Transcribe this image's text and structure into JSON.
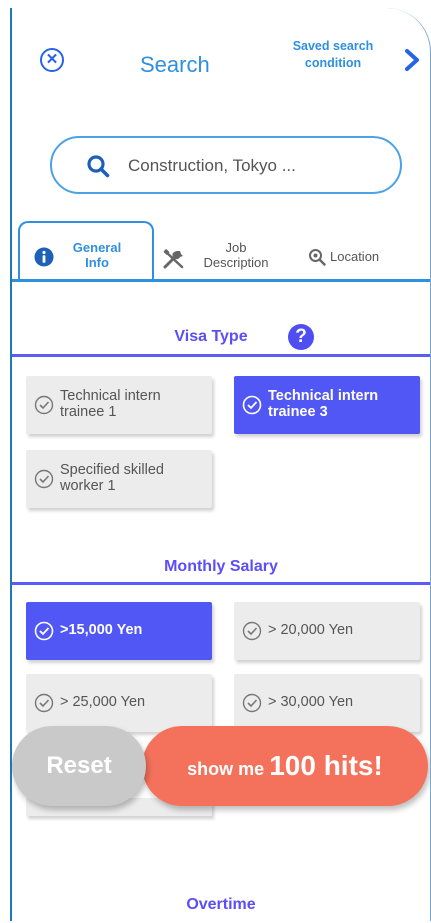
{
  "header": {
    "title": "Search",
    "saved_line1": "Saved search",
    "saved_line2": "condition"
  },
  "search": {
    "placeholder": "Construction, Tokyo ..."
  },
  "tabs": [
    {
      "line1": "General",
      "line2": "Info",
      "active": true
    },
    {
      "line1": "Job",
      "line2": "Description",
      "active": false
    },
    {
      "label": "Location",
      "active": false
    }
  ],
  "visa": {
    "title": "Visa Type",
    "help": "?",
    "options": [
      {
        "line1": "Technical intern",
        "line2": "trainee 1",
        "selected": false
      },
      {
        "line1": "Technical intern",
        "line2": "trainee 3",
        "selected": true
      },
      {
        "line1": "Specified skilled",
        "line2": "worker 1",
        "selected": false
      }
    ]
  },
  "salary": {
    "title": "Monthly Salary",
    "options": [
      {
        "label": ">15,000 Yen",
        "selected": true
      },
      {
        "label": "> 20,000 Yen",
        "selected": false
      },
      {
        "label": "> 25,000 Yen",
        "selected": false
      },
      {
        "label": "> 30,000 Yen",
        "selected": false
      }
    ]
  },
  "actions": {
    "reset": "Reset",
    "hits_prefix": "show me ",
    "hits_count": "100 hits!"
  },
  "overtime": {
    "title": "Overtime"
  },
  "colors": {
    "accent_blue": "#2f8fe0",
    "selected_chip": "#5157f5",
    "cta": "#f4725b",
    "reset": "#c9c9c9"
  }
}
